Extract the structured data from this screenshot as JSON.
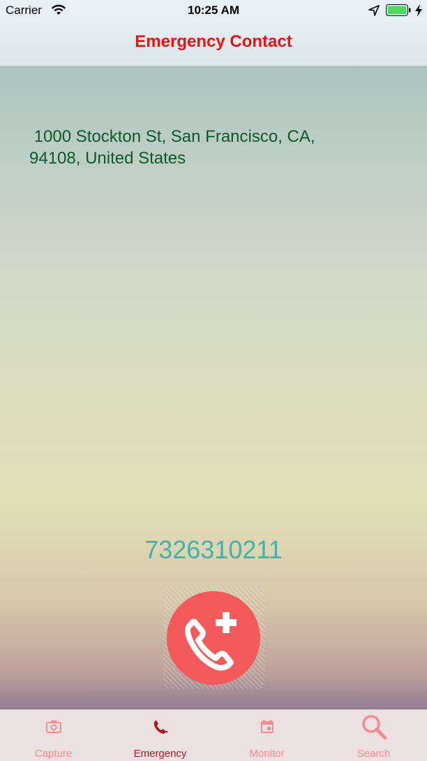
{
  "status_bar": {
    "carrier": "Carrier",
    "time": "10:25 AM",
    "icons": [
      "wifi-icon",
      "location-arrow-icon",
      "battery-icon",
      "charging-bolt-icon"
    ],
    "battery_color": "#4cd964"
  },
  "nav": {
    "title": "Emergency Contact",
    "title_color": "#f20f0f"
  },
  "content": {
    "address": " 1000 Stockton St, San Francisco, CA,\n94108, United States",
    "phone": "7326310211",
    "call_button_icon": "phone-plus-icon",
    "call_button_color": "#f45a5a"
  },
  "tab_bar": {
    "active_index": 1,
    "tabs": [
      {
        "label": "Capture",
        "icon": "camera-icon"
      },
      {
        "label": "Emergency",
        "icon": "phone-dots-icon"
      },
      {
        "label": "Monitor",
        "icon": "calendar-icon"
      },
      {
        "label": "Search",
        "icon": "search-icon"
      }
    ],
    "inactive_color": "#f48e8e",
    "active_color": "#a81d1d"
  }
}
